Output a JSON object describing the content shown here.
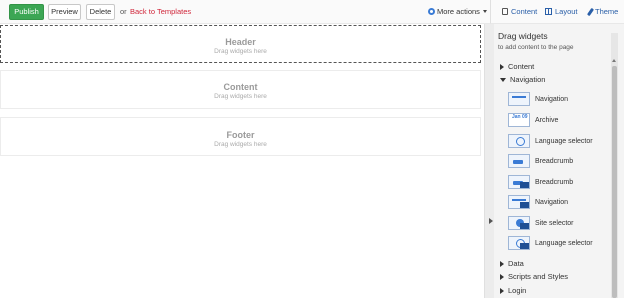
{
  "toolbar": {
    "publish": "Publish",
    "preview": "Preview",
    "delete": "Delete",
    "or": "or",
    "back": "Back to Templates",
    "more_actions": "More actions"
  },
  "modes": {
    "content": "Content",
    "layout": "Layout",
    "theme": "Theme"
  },
  "canvas": {
    "header": {
      "title": "Header",
      "hint": "Drag widgets here"
    },
    "content": {
      "title": "Content",
      "hint": "Drag widgets here"
    },
    "footer": {
      "title": "Footer",
      "hint": "Drag widgets here"
    }
  },
  "panel": {
    "title": "Drag widgets",
    "subtitle": "to add content to the page",
    "categories": {
      "content": "Content",
      "navigation": "Navigation",
      "data": "Data",
      "scripts": "Scripts and Styles",
      "login": "Login"
    },
    "navigation_widgets": [
      {
        "label": "Navigation",
        "icon": "navigation-icon"
      },
      {
        "label": "Archive",
        "icon": "calendar-icon",
        "icon_text": "Jan 09"
      },
      {
        "label": "Language selector",
        "icon": "globe-icon"
      },
      {
        "label": "Breadcrumb",
        "icon": "breadcrumb-icon"
      },
      {
        "label": "Breadcrumb",
        "icon": "breadcrumb-mvc-icon"
      },
      {
        "label": "Navigation",
        "icon": "navigation-mvc-icon"
      },
      {
        "label": "Site selector",
        "icon": "site-selector-icon"
      },
      {
        "label": "Language selector",
        "icon": "globe-mvc-icon"
      }
    ]
  },
  "colors": {
    "publish": "#3ca654",
    "link": "#d0263a",
    "accent": "#2a5fa8"
  }
}
